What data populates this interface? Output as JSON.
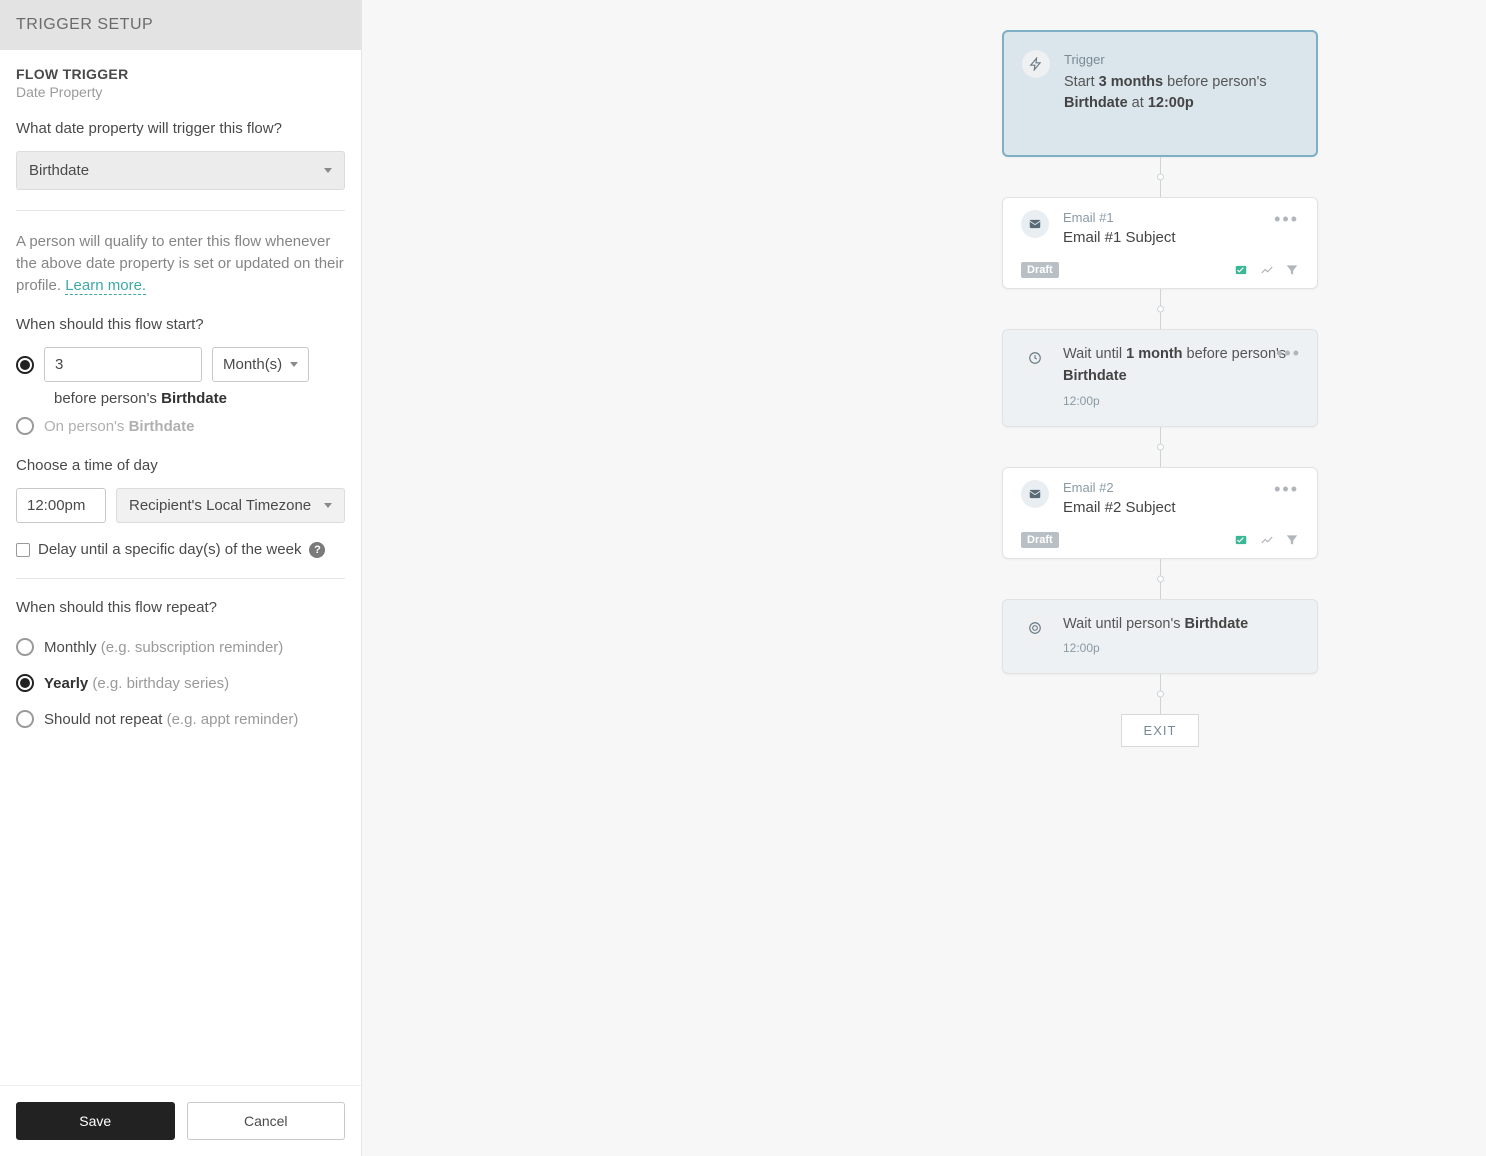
{
  "sidebar": {
    "header": "TRIGGER SETUP",
    "section_label": "FLOW TRIGGER",
    "section_sub": "Date Property",
    "q_property": "What date property will trigger this flow?",
    "property_value": "Birthdate",
    "helper_pre": "A person will qualify to enter this flow whenever the above date property is set or updated on their profile. ",
    "helper_link": "Learn more.",
    "q_start": "When should this flow start?",
    "offset_value": "3",
    "offset_unit": "Month(s)",
    "before_prefix": "before person's ",
    "before_prop": "Birthdate",
    "on_prefix": "On person's ",
    "on_prop": "Birthdate",
    "q_time": "Choose a time of day",
    "time_value": "12:00pm",
    "tz_value": "Recipient's Local Timezone",
    "delay_label": "Delay until a specific day(s) of the week",
    "q_repeat": "When should this flow repeat?",
    "repeat": {
      "monthly": "Monthly ",
      "monthly_hint": "(e.g. subscription reminder)",
      "yearly": "Yearly ",
      "yearly_hint": "(e.g. birthday series)",
      "none": "Should not repeat ",
      "none_hint": "(e.g. appt reminder)"
    },
    "save": "Save",
    "cancel": "Cancel"
  },
  "flow": {
    "trigger": {
      "title": "Trigger",
      "line_p1": "Start ",
      "line_b1": "3 months",
      "line_p2": " before person's ",
      "line_b2": "Birthdate",
      "line_p3": " at ",
      "line_b3": "12:00p"
    },
    "email1": {
      "name": "Email #1",
      "subject": "Email #1 Subject",
      "status": "Draft"
    },
    "wait1": {
      "p1": "Wait until ",
      "b1": "1 month",
      "p2": " before person's ",
      "b2": "Birthdate",
      "time": "12:00p"
    },
    "email2": {
      "name": "Email #2",
      "subject": "Email #2 Subject",
      "status": "Draft"
    },
    "wait2": {
      "p1": "Wait until person's ",
      "b1": "Birthdate",
      "time": "12:00p"
    },
    "exit": "EXIT"
  }
}
